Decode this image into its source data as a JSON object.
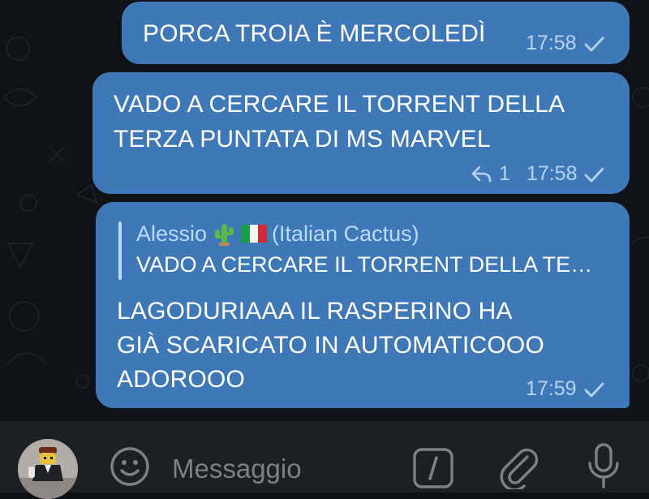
{
  "messages": [
    {
      "text_lines": [
        "PORCA TROIA È MERCOLEDÌ"
      ],
      "time": "17:58",
      "status": "sent-check-icon"
    },
    {
      "text_lines": [
        "VADO A CERCARE IL TORRENT DELLA",
        "TERZA PUNTATA DI MS MARVEL"
      ],
      "reply_count": "1",
      "time": "17:58",
      "status": "sent-check-icon"
    },
    {
      "reply": {
        "author": "Alessio",
        "author_suffix": "(Italian Cactus)",
        "quoted_text": "VADO A CERCARE IL TORRENT DELLA TE…"
      },
      "text_lines": [
        "LAGODURIAAA IL RASPERINO HA",
        "GIÀ SCARICATO IN AUTOMATICOOO",
        "ADOROOO"
      ],
      "time": "17:59",
      "status": "sent-check-icon"
    }
  ],
  "input_bar": {
    "placeholder": "Messaggio",
    "icons": [
      "avatar",
      "emoji-icon",
      "slash-command-icon",
      "attach-icon",
      "microphone-icon"
    ]
  },
  "colors": {
    "bubble": "#3f78b6",
    "reply_accent": "#b8dbff",
    "meta_text": "#b7d3f2",
    "input_bar": "#1c1f23"
  }
}
